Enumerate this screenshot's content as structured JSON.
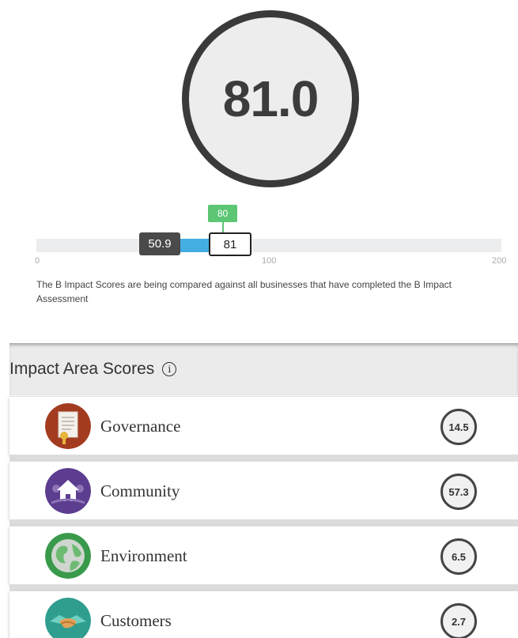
{
  "overall": {
    "score": "81.0"
  },
  "comparison": {
    "median_label": "50.9",
    "company_label": "81",
    "previous_label": "80",
    "median_value": 50.9,
    "company_value": 81,
    "axis_min": 0,
    "axis_max": 200,
    "ticks": [
      "0",
      "100",
      "200"
    ],
    "note": "The B Impact Scores are being compared against all businesses that have completed the B Impact Assessment",
    "colors": {
      "fill": "#43aee2",
      "median": "#4a4a4a",
      "previous": "#5cc675"
    }
  },
  "impact_areas": {
    "title": "Impact Area Scores",
    "info_icon": "info-icon",
    "items": [
      {
        "label": "Governance",
        "score": "14.5",
        "icon": "governance-icon",
        "color": "#a33b20"
      },
      {
        "label": "Community",
        "score": "57.3",
        "icon": "community-icon",
        "color": "#5c3d8f"
      },
      {
        "label": "Environment",
        "score": "6.5",
        "icon": "environment-icon",
        "color": "#3a9a4b"
      },
      {
        "label": "Customers",
        "score": "2.7",
        "icon": "customers-icon",
        "color": "#2f9e8f"
      }
    ]
  }
}
